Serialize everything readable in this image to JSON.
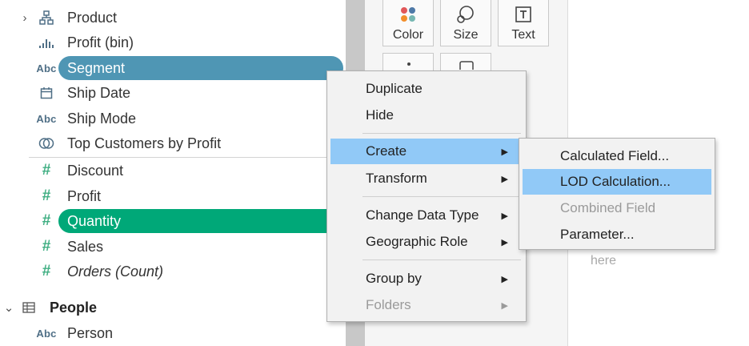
{
  "fields": [
    {
      "id": "product",
      "label": "Product",
      "icon": "hierarchy-icon",
      "has_expander": true
    },
    {
      "id": "profit-bin",
      "label": "Profit (bin)",
      "icon": "bin-histogram-icon"
    },
    {
      "id": "segment",
      "label": "Segment",
      "icon_text": "Abc",
      "state": "selected-dimension"
    },
    {
      "id": "ship-date",
      "label": "Ship Date",
      "icon": "calendar-icon"
    },
    {
      "id": "ship-mode",
      "label": "Ship Mode",
      "icon_text": "Abc"
    },
    {
      "id": "top-customers",
      "label": "Top Customers by Profit",
      "icon": "set-icon"
    },
    {
      "id": "discount",
      "label": "Discount",
      "icon_text": "#"
    },
    {
      "id": "profit",
      "label": "Profit",
      "icon_text": "#"
    },
    {
      "id": "quantity",
      "label": "Quantity",
      "icon_text": "#",
      "state": "selected-measure"
    },
    {
      "id": "sales",
      "label": "Sales",
      "icon_text": "#"
    },
    {
      "id": "orders-count",
      "label": "Orders (Count)",
      "icon_text": "#",
      "italic": true
    }
  ],
  "people_group": {
    "label": "People",
    "icon": "table-icon",
    "expanded": true
  },
  "people_fields": [
    {
      "id": "person",
      "label": "Person",
      "icon_text": "Abc"
    }
  ],
  "marks": {
    "color_label": "Color",
    "size_label": "Size",
    "text_label": "Text",
    "drop_hint": "here"
  },
  "context_menu": {
    "items": [
      {
        "label": "Duplicate"
      },
      {
        "label": "Hide"
      },
      {
        "label": "Create",
        "has_submenu": true,
        "selected": true
      },
      {
        "label": "Transform",
        "has_submenu": true
      },
      {
        "label": "Change Data Type",
        "has_submenu": true
      },
      {
        "label": "Geographic Role",
        "has_submenu": true
      },
      {
        "label": "Group by",
        "has_submenu": true
      },
      {
        "label": "Folders",
        "has_submenu": true,
        "disabled": true
      }
    ]
  },
  "create_submenu": {
    "items": [
      {
        "label": "Calculated Field..."
      },
      {
        "label": "LOD Calculation...",
        "selected": true
      },
      {
        "label": "Combined Field",
        "disabled": true
      },
      {
        "label": "Parameter..."
      }
    ]
  },
  "colors": {
    "dimension_pill": "#4f96b4",
    "measure_pill": "#00a878",
    "menu_highlight": "#91c9f7",
    "measure_icon": "#3fae82"
  }
}
